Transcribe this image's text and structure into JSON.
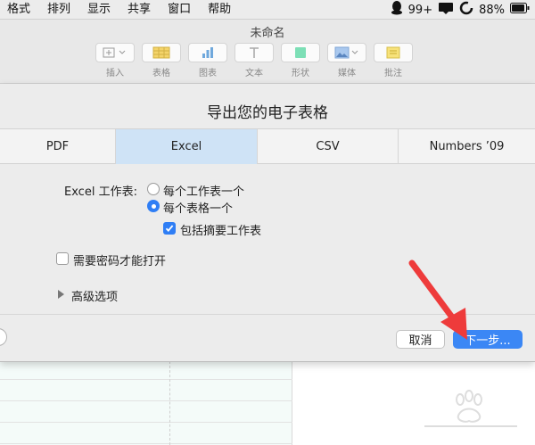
{
  "menubar": {
    "items": [
      "格式",
      "排列",
      "显示",
      "共享",
      "窗口",
      "帮助"
    ],
    "qq_count": "99+",
    "battery": "88%"
  },
  "toolbar": {
    "doc_title": "未命名",
    "tools": [
      {
        "label": "插入",
        "icon": "insert-icon"
      },
      {
        "label": "表格",
        "icon": "table-icon"
      },
      {
        "label": "图表",
        "icon": "chart-icon"
      },
      {
        "label": "文本",
        "icon": "text-icon"
      },
      {
        "label": "形状",
        "icon": "shape-icon"
      },
      {
        "label": "媒体",
        "icon": "media-icon"
      },
      {
        "label": "批注",
        "icon": "comment-icon"
      }
    ]
  },
  "dialog": {
    "title": "导出您的电子表格",
    "tabs": [
      "PDF",
      "Excel",
      "CSV",
      "Numbers ’09"
    ],
    "selected_tab": "Excel",
    "worksheets_label": "Excel 工作表:",
    "radio_one_per_sheet": "每个工作表一个",
    "radio_one_per_table": "每个表格一个",
    "checkbox_summary": "包括摘要工作表",
    "checkbox_password": "需要密码才能打开",
    "advanced": "高级选项",
    "cancel": "取消",
    "next": "下一步..."
  },
  "colors": {
    "accent": "#3b87f5",
    "selected_tab": "#cfe3f6",
    "annotation_arrow": "#ee3b3b"
  }
}
